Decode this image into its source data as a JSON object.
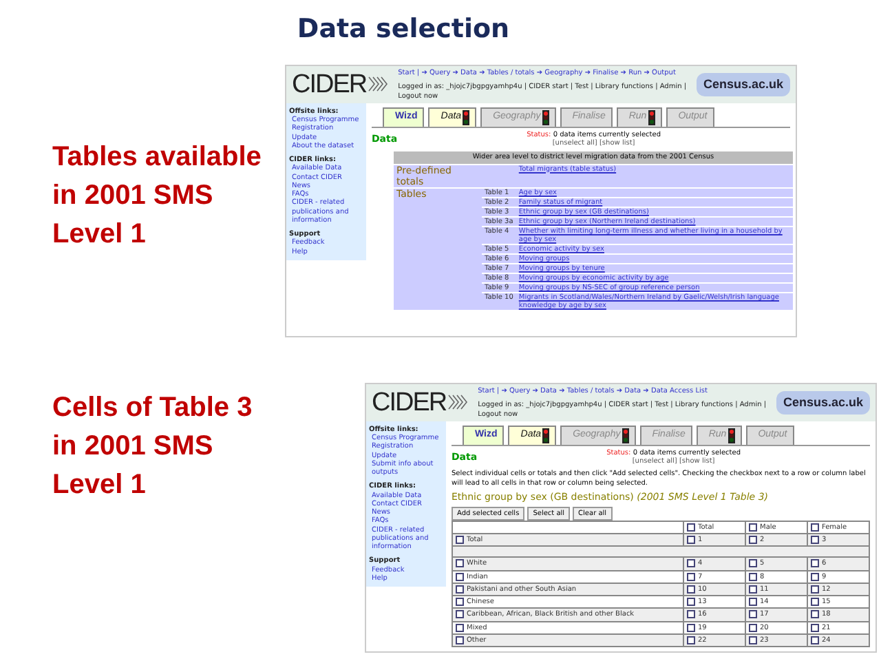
{
  "title": "Data selection",
  "captions": [
    "Tables available in 2001 SMS Level 1",
    "Cells of Table 3 in 2001 SMS Level 1"
  ],
  "screenshots": [
    {
      "kind": "tables_list",
      "breadcrumb": "Start | ➔ Query ➔ Data ➔ Tables / totals ➔ Geography ➔ Finalise ➔ Run ➔ Output",
      "login": "Logged in as: _hjojc7jbgpgyamhp4u | CIDER start | Test | Library functions | Admin | Logout now",
      "logo": "CIDER",
      "badge": "Census.ac.uk",
      "sidebar": [
        {
          "heading": "Offsite links:",
          "links": [
            "Census Programme",
            "Registration",
            "Update",
            "About the dataset"
          ]
        },
        {
          "heading": "CIDER links:",
          "links": [
            "Available Data",
            "Contact CIDER",
            "News",
            "FAQs",
            "CIDER - related publications and information"
          ]
        },
        {
          "heading": "Support",
          "links": [
            "Feedback",
            "Help"
          ]
        }
      ],
      "tabs": [
        {
          "label": "Wizd",
          "selected": false,
          "light": false
        },
        {
          "label": "Data",
          "selected": true,
          "light": true
        },
        {
          "label": "Geography",
          "selected": false,
          "light": true
        },
        {
          "label": "Finalise",
          "selected": false,
          "light": false
        },
        {
          "label": "Run",
          "selected": false,
          "light": true
        },
        {
          "label": "Output",
          "selected": false,
          "light": false
        }
      ],
      "heading": "Data",
      "status_label": "Status:",
      "status": "0 data items currently selected",
      "status_links": "[unselect all] [show list]",
      "table_title": "Wider area level to district level migration data from the 2001 Census",
      "groups": [
        {
          "name": "Pre-defined totals",
          "items": [
            {
              "title": "Total migrants (table status)"
            }
          ]
        },
        {
          "name": "Tables",
          "items": [
            {
              "label": "Table 1",
              "title": "Age by sex"
            },
            {
              "label": "Table 2",
              "title": "Family status of migrant"
            },
            {
              "label": "Table 3",
              "title": "Ethnic group by sex (GB destinations)"
            },
            {
              "label": "Table 3a",
              "title": "Ethnic group by sex (Northern Ireland destinations)"
            },
            {
              "label": "Table 4",
              "title": "Whether with limiting long-term illness and whether living in a household by age by sex"
            },
            {
              "label": "Table 5",
              "title": "Economic activity by sex"
            },
            {
              "label": "Table 6",
              "title": "Moving groups"
            },
            {
              "label": "Table 7",
              "title": "Moving groups by tenure"
            },
            {
              "label": "Table 8",
              "title": "Moving groups by economic activity by age"
            },
            {
              "label": "Table 9",
              "title": "Moving groups by NS-SEC of group reference person"
            },
            {
              "label": "Table 10",
              "title": "Migrants in Scotland/Wales/Northern Ireland by Gaelic/Welsh/Irish language knowledge by age by sex"
            }
          ]
        }
      ]
    },
    {
      "kind": "cells_grid",
      "breadcrumb": "Start | ➔ Query ➔ Data ➔ Tables / totals ➔ Data ➔ Data Access List",
      "login": "Logged in as: _hjojc7jbgpgyamhp4u | CIDER start | Test | Library functions | Admin | Logout now",
      "logo": "CIDER",
      "badge": "Census.ac.uk",
      "sidebar": [
        {
          "heading": "Offsite links:",
          "links": [
            "Census Programme",
            "Registration",
            "Update",
            "Submit info about outputs"
          ]
        },
        {
          "heading": "CIDER links:",
          "links": [
            "Available Data",
            "Contact CIDER",
            "News",
            "FAQs",
            "CIDER - related publications and information"
          ]
        },
        {
          "heading": "Support",
          "links": [
            "Feedback",
            "Help"
          ]
        }
      ],
      "tabs": [
        {
          "label": "Wizd",
          "selected": false,
          "light": false
        },
        {
          "label": "Data",
          "selected": true,
          "light": true
        },
        {
          "label": "Geography",
          "selected": false,
          "light": true
        },
        {
          "label": "Finalise",
          "selected": false,
          "light": false
        },
        {
          "label": "Run",
          "selected": false,
          "light": true
        },
        {
          "label": "Output",
          "selected": false,
          "light": false
        }
      ],
      "heading": "Data",
      "status_label": "Status:",
      "status": "0 data items currently selected",
      "status_links": "[unselect all] [show list]",
      "instructions": "Select individual cells or totals and then click \"Add selected cells\". Checking the checkbox next to a row or column label will lead to all cells in that row or column being selected.",
      "table_title": "Ethnic group by sex (GB destinations)",
      "table_ref": "(2001 SMS Level 1 Table 3)",
      "buttons": [
        "Add selected cells",
        "Select all",
        "Clear all"
      ],
      "columns": [
        {
          "label": "Total",
          "checked": false
        },
        {
          "label": "Male",
          "checked": false
        },
        {
          "label": "Female",
          "checked": false
        }
      ],
      "rows": [
        {
          "kind": "cells",
          "label": "Total",
          "checked": false,
          "cells": [
            {
              "value": "1",
              "checked": false
            },
            {
              "value": "2",
              "checked": false
            },
            {
              "value": "3",
              "checked": false
            }
          ]
        },
        {
          "kind": "gap"
        },
        {
          "kind": "cells",
          "label": "White",
          "checked": false,
          "cells": [
            {
              "value": "4",
              "checked": false
            },
            {
              "value": "5",
              "checked": false
            },
            {
              "value": "6",
              "checked": false
            }
          ]
        },
        {
          "kind": "cells",
          "label": "Indian",
          "checked": false,
          "cells": [
            {
              "value": "7",
              "checked": false
            },
            {
              "value": "8",
              "checked": false
            },
            {
              "value": "9",
              "checked": false
            }
          ]
        },
        {
          "kind": "cells",
          "label": "Pakistani and other South Asian",
          "checked": false,
          "cells": [
            {
              "value": "10",
              "checked": false
            },
            {
              "value": "11",
              "checked": false
            },
            {
              "value": "12",
              "checked": false
            }
          ]
        },
        {
          "kind": "cells",
          "label": "Chinese",
          "checked": false,
          "cells": [
            {
              "value": "13",
              "checked": false
            },
            {
              "value": "14",
              "checked": false
            },
            {
              "value": "15",
              "checked": false
            }
          ]
        },
        {
          "kind": "cells",
          "label": "Caribbean, African, Black British and other Black",
          "checked": false,
          "cells": [
            {
              "value": "16",
              "checked": false
            },
            {
              "value": "17",
              "checked": false
            },
            {
              "value": "18",
              "checked": false
            }
          ]
        },
        {
          "kind": "cells",
          "label": "Mixed",
          "checked": false,
          "cells": [
            {
              "value": "19",
              "checked": false
            },
            {
              "value": "20",
              "checked": false
            },
            {
              "value": "21",
              "checked": false
            }
          ]
        },
        {
          "kind": "cells",
          "label": "Other",
          "checked": false,
          "cells": [
            {
              "value": "22",
              "checked": false
            },
            {
              "value": "23",
              "checked": false
            },
            {
              "value": "24",
              "checked": false
            }
          ]
        }
      ]
    }
  ]
}
